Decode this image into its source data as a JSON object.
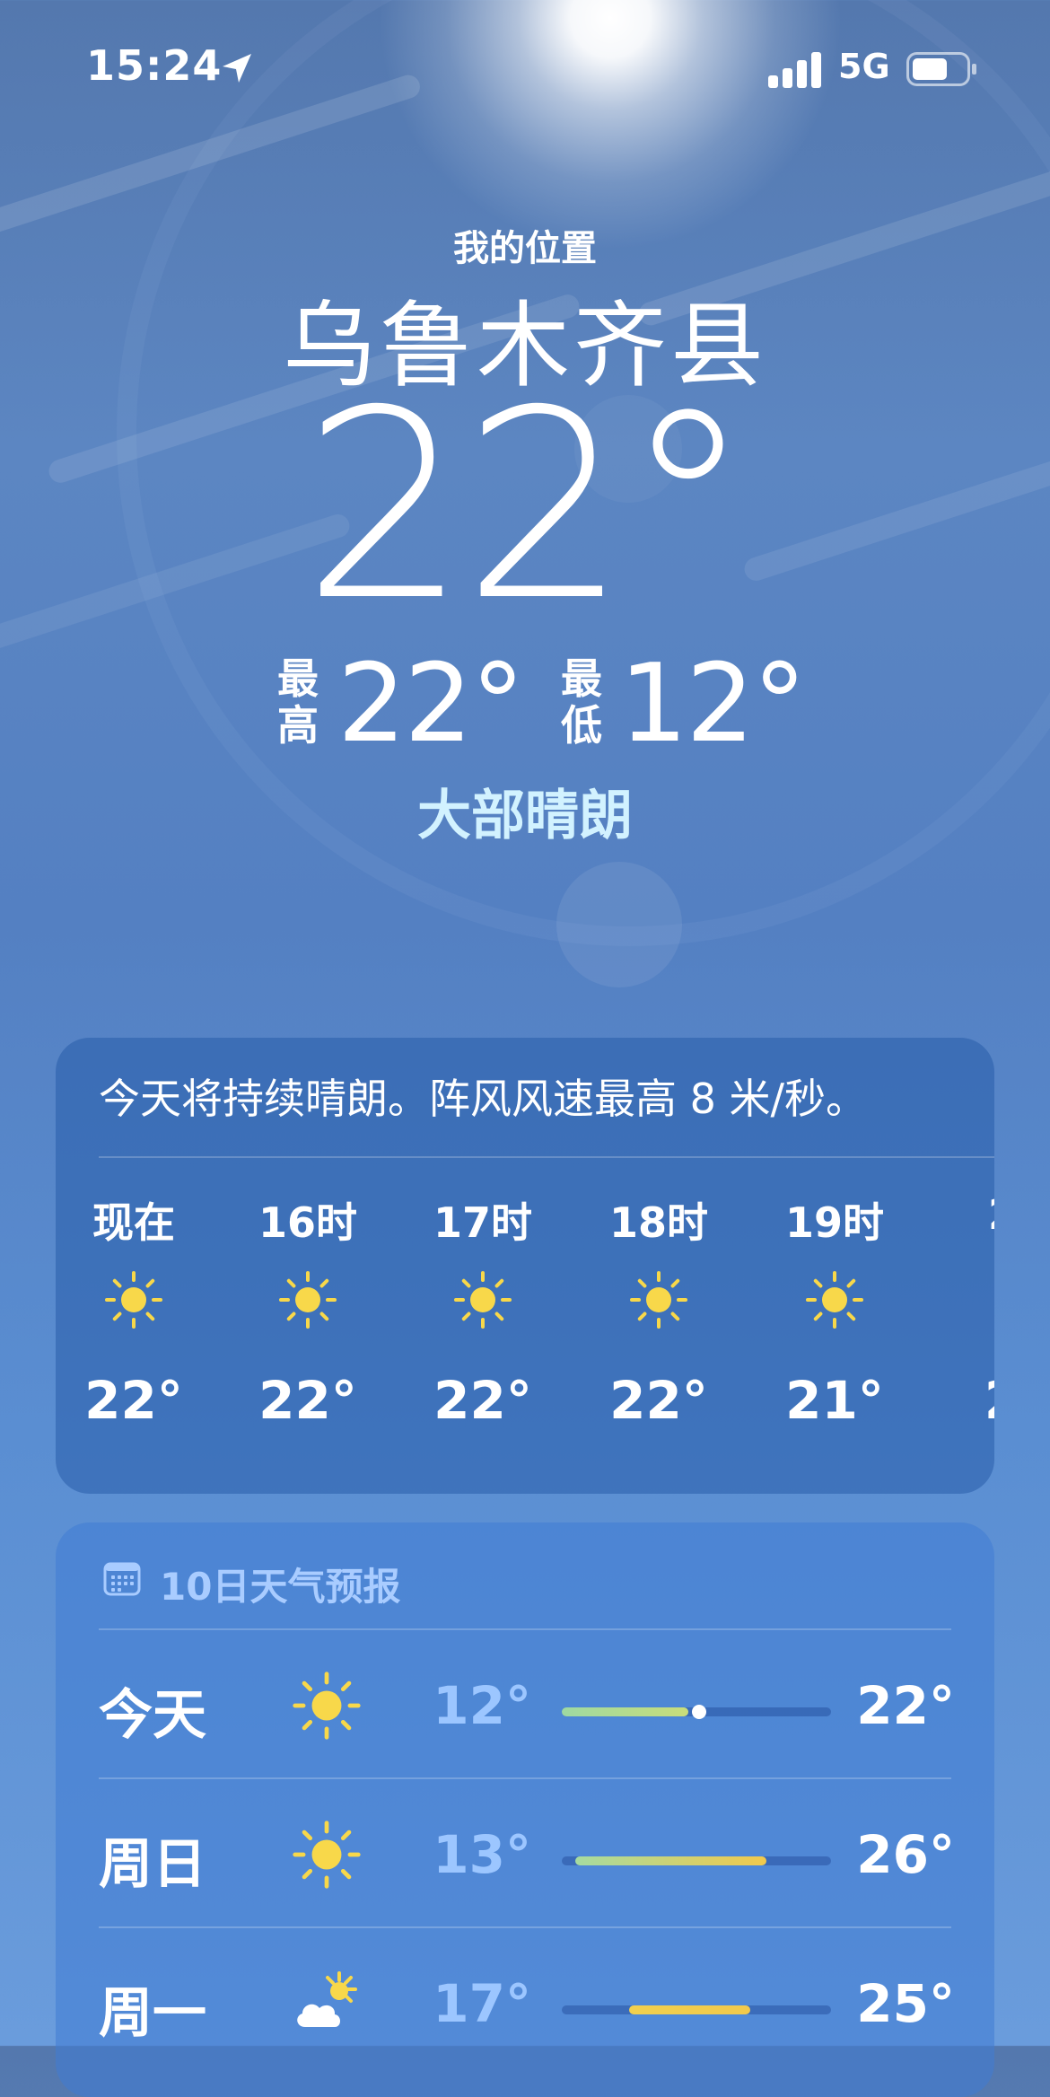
{
  "status_bar": {
    "time": "15:24",
    "network": "5G",
    "icons": [
      "location-arrow-icon",
      "signal-bars-icon",
      "battery-icon"
    ]
  },
  "header": {
    "caption": "我的位置",
    "city": "乌鲁木齐县",
    "current_temp": "22°",
    "high_label": "最高",
    "high_temp": "22°",
    "low_label": "最低",
    "low_temp": "12°",
    "condition": "大部晴朗"
  },
  "hourly": {
    "summary": "今天将持续晴朗。阵风风速最高 8 米/秒。",
    "items": [
      {
        "time": "现在",
        "icon": "sun-icon",
        "temp": "22°"
      },
      {
        "time": "16时",
        "icon": "sun-icon",
        "temp": "22°"
      },
      {
        "time": "17时",
        "icon": "sun-icon",
        "temp": "22°"
      },
      {
        "time": "18时",
        "icon": "sun-icon",
        "temp": "22°"
      },
      {
        "time": "19时",
        "icon": "sun-icon",
        "temp": "21°"
      },
      {
        "time": "2",
        "icon": "sun-icon",
        "temp": "2"
      }
    ]
  },
  "forecast": {
    "title": "10日天气预报",
    "icon": "calendar-icon",
    "days": [
      {
        "name": "今天",
        "icon": "sun-icon",
        "low": "12°",
        "high": "22°",
        "range_start": 0.0,
        "range_end": 0.47,
        "current_marker": 0.51,
        "bar_color_start": "#9ed9a2",
        "bar_color_end": "#c9dd7a"
      },
      {
        "name": "周日",
        "icon": "sun-icon",
        "low": "13°",
        "high": "26°",
        "range_start": 0.05,
        "range_end": 0.76,
        "current_marker": null,
        "bar_color_start": "#a6dba0",
        "bar_color_end": "#f2c94c"
      },
      {
        "name": "周一",
        "icon": "partly-cloudy-icon",
        "low": "17°",
        "high": "25°",
        "range_start": 0.25,
        "range_end": 0.7,
        "current_marker": null,
        "bar_color_start": "#f2d04e",
        "bar_color_end": "#f2c94c"
      }
    ]
  },
  "colors": {
    "sun": "#f8d84a",
    "condition_text": "#d2f2ff",
    "low_temp_text": "#9cc6ff"
  }
}
